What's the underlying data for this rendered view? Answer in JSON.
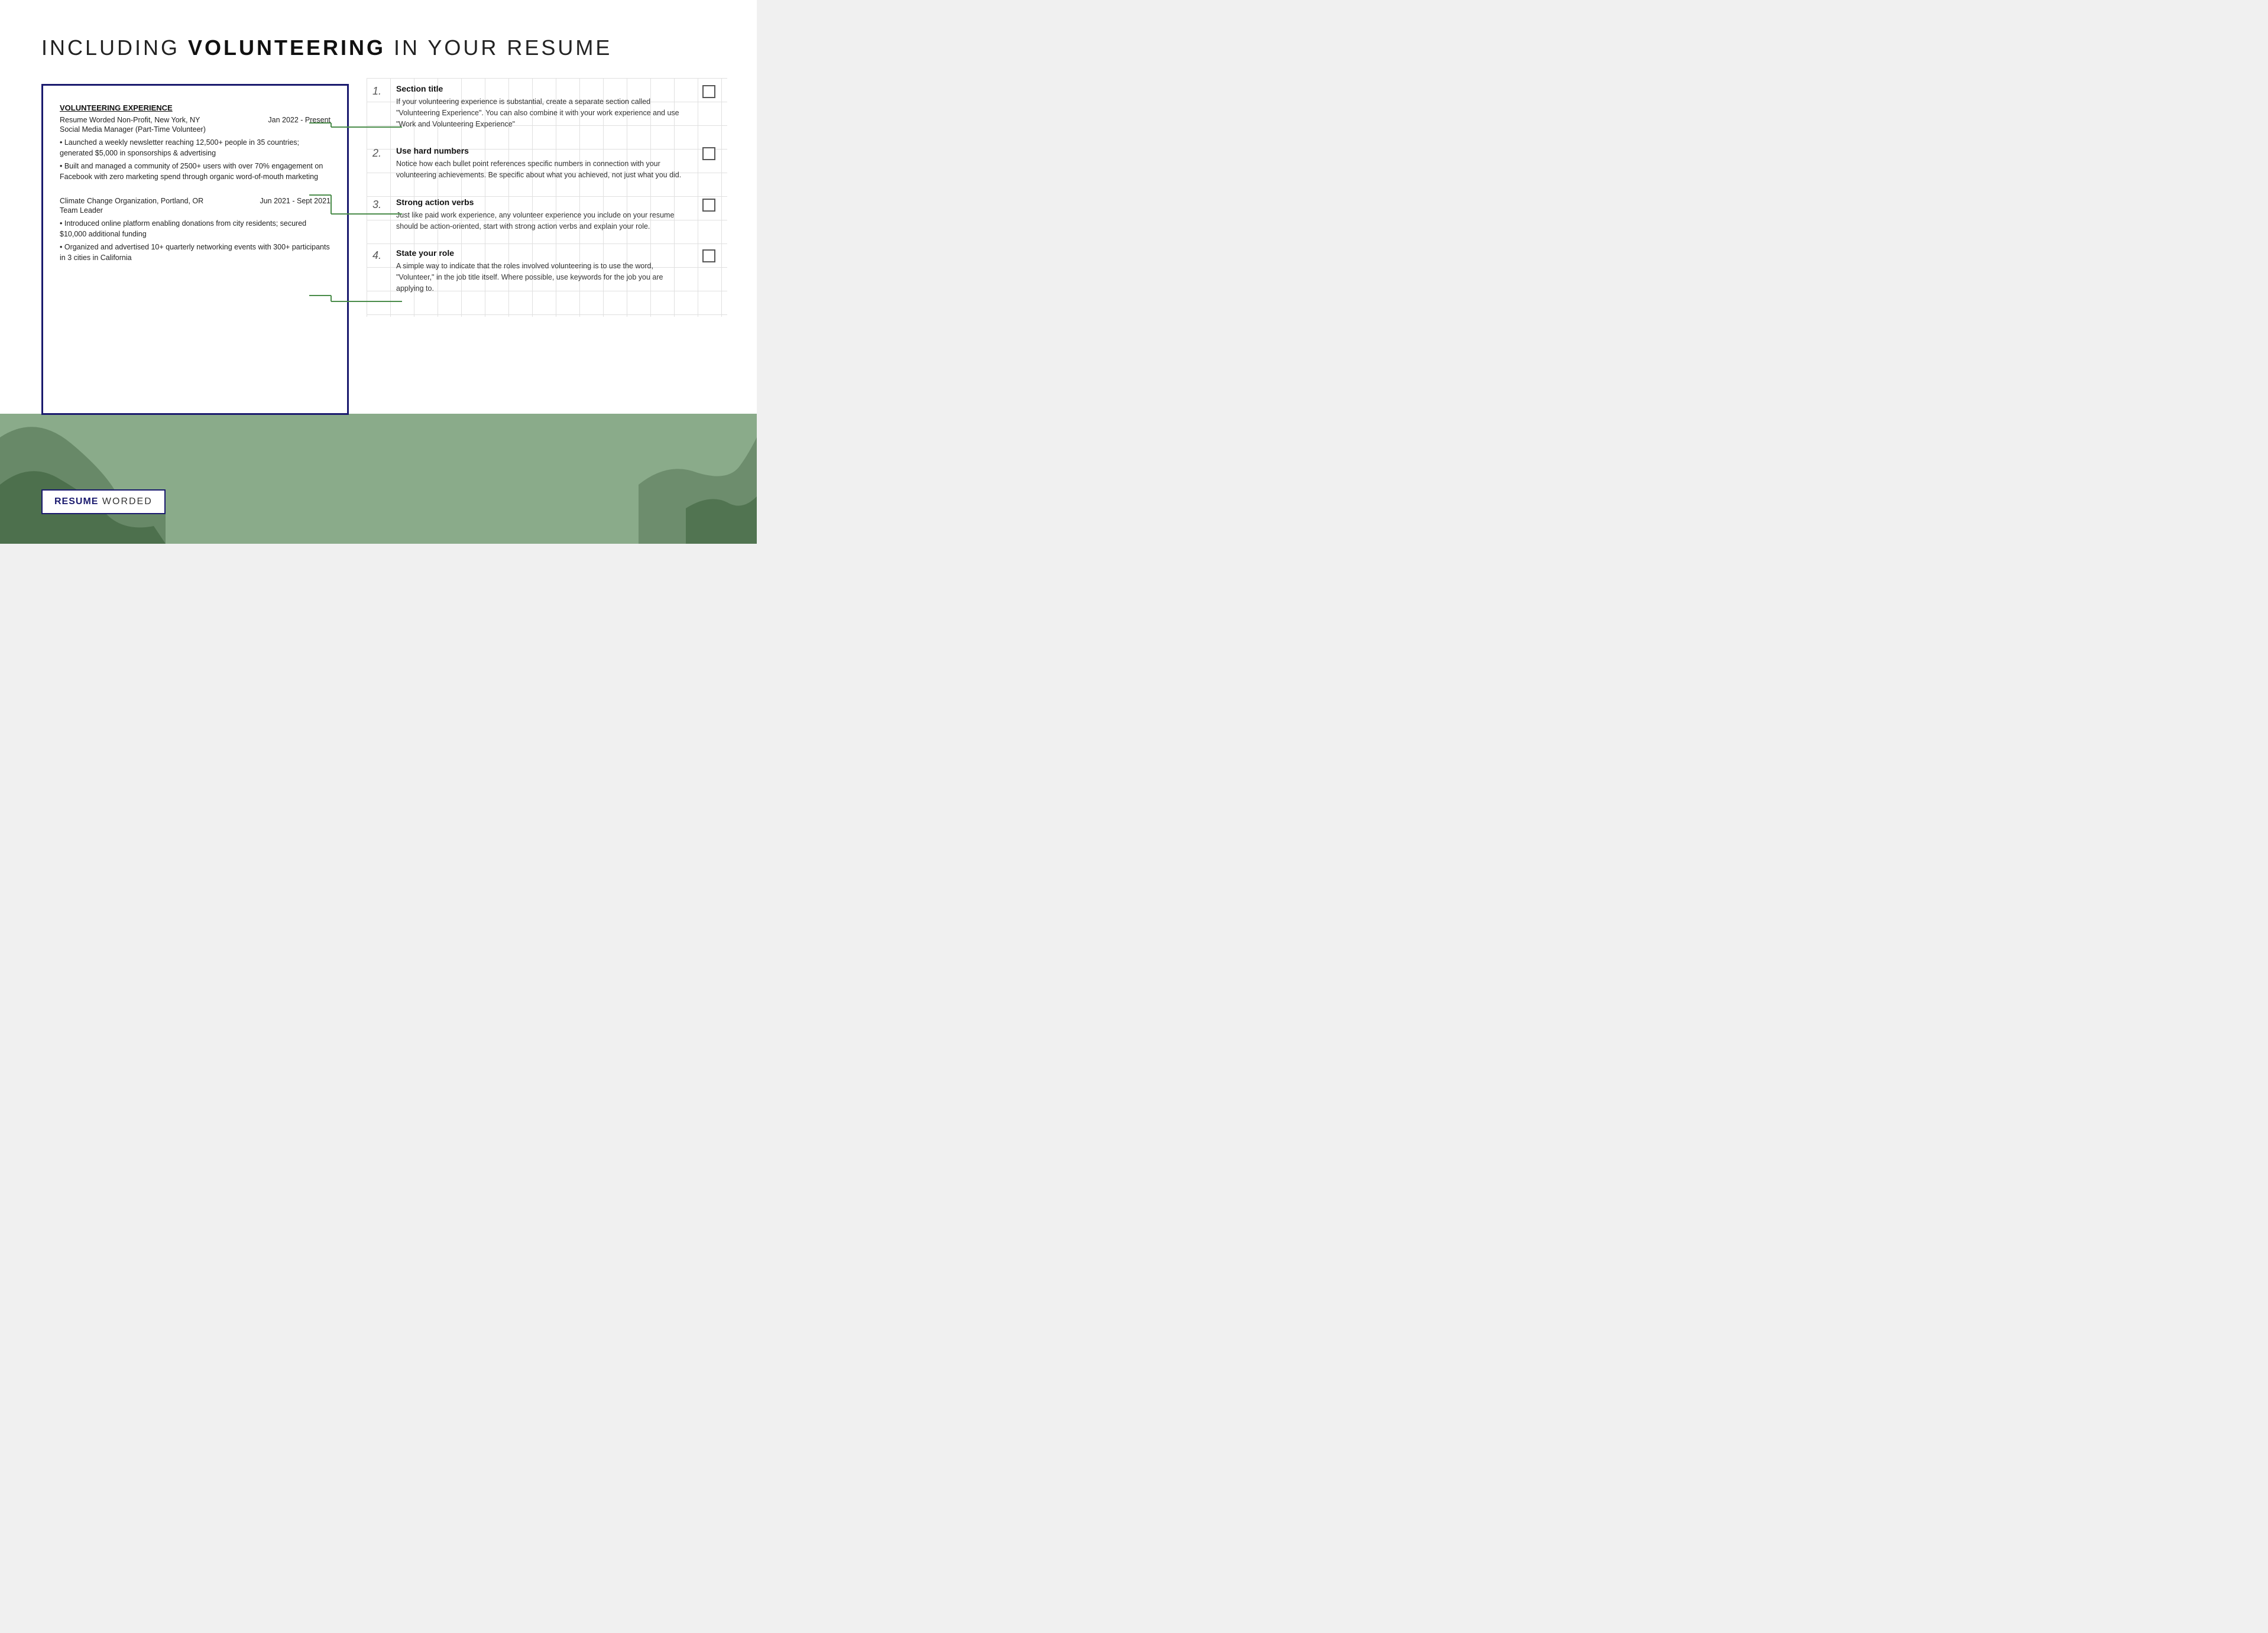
{
  "page": {
    "title_normal": "INCLUDING ",
    "title_bold": "VOLUNTEERING",
    "title_end": " IN YOUR RESUME"
  },
  "resume": {
    "section_title": "VOLUNTEERING EXPERIENCE",
    "entry1": {
      "org": "Resume Worded Non-Profit, New York, NY",
      "dates": "Jan 2022 - Present",
      "role": "Social Media Manager (Part-Time Volunteer)",
      "bullets": [
        "• Launched a weekly newsletter reaching 12,500+ people in 35 countries; generated $5,000 in sponsorships & advertising",
        "• Built and managed a community of 2500+ users with over 70% engagement on Facebook with zero marketing spend through organic word-of-mouth marketing"
      ]
    },
    "entry2": {
      "org": "Climate Change Organization, Portland, OR",
      "dates": "Jun 2021 - Sept 2021",
      "role": "Team Leader",
      "bullets": [
        "• Introduced online platform enabling donations from city residents; secured $10,000 additional funding",
        "• Organized and advertised 10+ quarterly networking events with 300+ participants in 3 cities in California"
      ]
    }
  },
  "tips": [
    {
      "number": "1.",
      "title": "Section title",
      "description": "If your volunteering experience is substantial, create a separate section called \"Volunteering Experience\". You can also combine it with your work experience and use \"Work and Volunteering Experience\""
    },
    {
      "number": "2.",
      "title": "Use hard numbers",
      "description": "Notice how each bullet point references specific numbers in connection with your volunteering achievements. Be specific about what you achieved, not just what you did."
    },
    {
      "number": "3.",
      "title": "Strong action verbs",
      "description": "Just like paid work experience, any volunteer experience you include on your resume should be action-oriented, start with strong action verbs and explain your role."
    },
    {
      "number": "4.",
      "title": "State your role",
      "description": "A simple way to indicate that the roles involved volunteering is to use the word, \"Volunteer,\" in the job title itself. Where possible, use keywords for the job you are applying to."
    }
  ],
  "branding": {
    "bold": "RESUME",
    "normal": " WORDED"
  }
}
